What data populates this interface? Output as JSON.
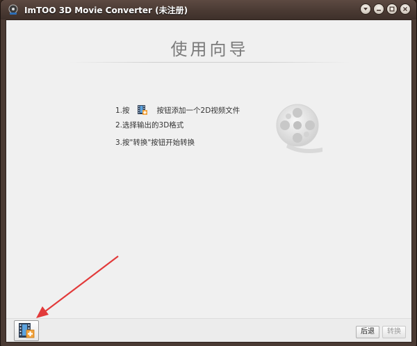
{
  "window": {
    "title": "ImTOO 3D Movie Converter (未注册)"
  },
  "wizard": {
    "title": "使用向导",
    "step1_prefix": "1.按",
    "step1_suffix": "按钮添加一个2D视频文件",
    "step2": "2.选择输出的3D格式",
    "step3": "3.按\"转换\"按钮开始转换"
  },
  "footer": {
    "back_label": "后退",
    "convert_label": "转换"
  },
  "icons": {
    "app": "app-icon",
    "minimize": "minimize-icon",
    "restore": "restore-icon",
    "menu": "menu-icon",
    "close": "close-icon",
    "add_file": "add-file-icon",
    "film_reel": "film-reel-icon"
  },
  "colors": {
    "titlebar": "#4a3a33",
    "client_bg": "#f0f0f0",
    "arrow": "#e23a3a",
    "accent_orange": "#f2a23a"
  }
}
